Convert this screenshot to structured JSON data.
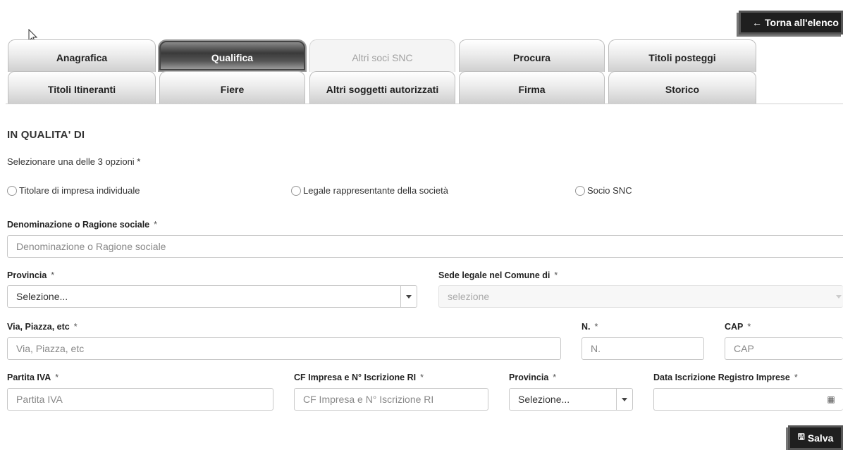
{
  "header": {
    "back_label": "Torna all'elenco",
    "back_icon": "arrow-left-icon"
  },
  "tabs": {
    "row1": [
      {
        "label": "Anagrafica",
        "state": "normal"
      },
      {
        "label": "Qualifica",
        "state": "active"
      },
      {
        "label": "Altri soci SNC",
        "state": "disabled"
      },
      {
        "label": "Procura",
        "state": "normal"
      },
      {
        "label": "Titoli posteggi",
        "state": "normal"
      }
    ],
    "row2": [
      {
        "label": "Titoli Itineranti",
        "state": "normal"
      },
      {
        "label": "Fiere",
        "state": "normal"
      },
      {
        "label": "Altri soggetti autorizzati",
        "state": "normal"
      },
      {
        "label": "Firma",
        "state": "normal"
      },
      {
        "label": "Storico",
        "state": "normal"
      }
    ]
  },
  "form": {
    "section_title": "IN QUALITA' DI",
    "hint": "Selezionare una delle 3 opzioni *",
    "options": [
      {
        "label": "Titolare di impresa individuale",
        "checked": false
      },
      {
        "label": "Legale rappresentante della società",
        "checked": false
      },
      {
        "label": "Socio SNC",
        "checked": false
      }
    ],
    "required_mark": "*",
    "denominazione": {
      "label": "Denominazione o Ragione sociale",
      "placeholder": "Denominazione o Ragione sociale"
    },
    "provincia": {
      "label": "Provincia",
      "value": "Selezione..."
    },
    "sede_legale": {
      "label": "Sede legale nel Comune di",
      "value": "selezione"
    },
    "via": {
      "label": "Via, Piazza, etc",
      "placeholder": "Via, Piazza, etc"
    },
    "numero": {
      "label": "N.",
      "placeholder": "N."
    },
    "cap": {
      "label": "CAP",
      "placeholder": "CAP"
    },
    "partita_iva": {
      "label": "Partita IVA",
      "placeholder": "Partita IVA"
    },
    "cf_impresa": {
      "label": "CF Impresa e N° Iscrizione RI",
      "placeholder": "CF Impresa e N° Iscrizione RI"
    },
    "provincia2": {
      "label": "Provincia",
      "value": "Selezione..."
    },
    "data_iscrizione": {
      "label": "Data Iscrizione Registro Imprese",
      "value": ""
    }
  },
  "footer": {
    "save_label": "Salva",
    "save_icon": "floppy-disk-icon"
  }
}
